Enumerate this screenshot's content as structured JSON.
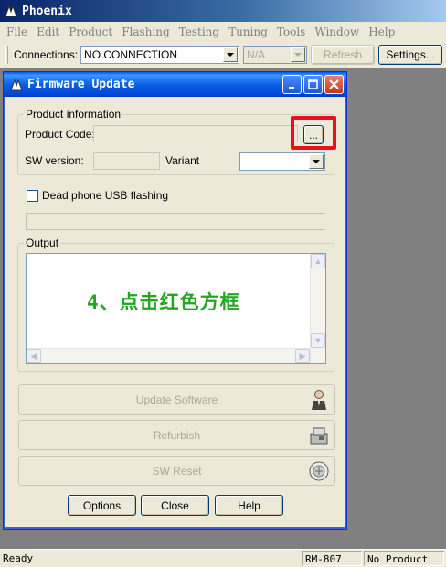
{
  "app": {
    "title": "Phoenix"
  },
  "menu": {
    "items": [
      "File",
      "Edit",
      "Product",
      "Flashing",
      "Testing",
      "Tuning",
      "Tools",
      "Window",
      "Help"
    ]
  },
  "toolbar": {
    "connections_label": "Connections:",
    "connection_value": "NO CONNECTION",
    "na_value": "N/A",
    "refresh_label": "Refresh",
    "settings_label": "Settings..."
  },
  "firmware_window": {
    "title": "Firmware Update",
    "product_info": {
      "group_label": "Product information",
      "product_code_label": "Product Code:",
      "product_code_value": "",
      "browse_label": "...",
      "sw_version_label": "SW version:",
      "sw_version_value": "",
      "variant_label": "Variant",
      "variant_value": ""
    },
    "dead_phone_label": "Dead phone USB flashing",
    "dead_phone_checked": false,
    "output_label": "Output",
    "overlay_text": "4、点击红色方框",
    "buttons": {
      "update_software": "Update Software",
      "refurbish": "Refurbish",
      "sw_reset": "SW Reset",
      "options": "Options",
      "close": "Close",
      "help": "Help"
    }
  },
  "status": {
    "ready": "Ready",
    "model": "RM-807",
    "product": "No Product"
  },
  "colors": {
    "highlight": "#e8101f",
    "overlay_text": "#23a623",
    "title_bar": "#0a5fe5"
  },
  "icons": [
    "phoenix-logo-icon",
    "minimize-icon",
    "maximize-icon",
    "close-icon",
    "person-icon",
    "refurbish-icon",
    "reset-icon"
  ]
}
